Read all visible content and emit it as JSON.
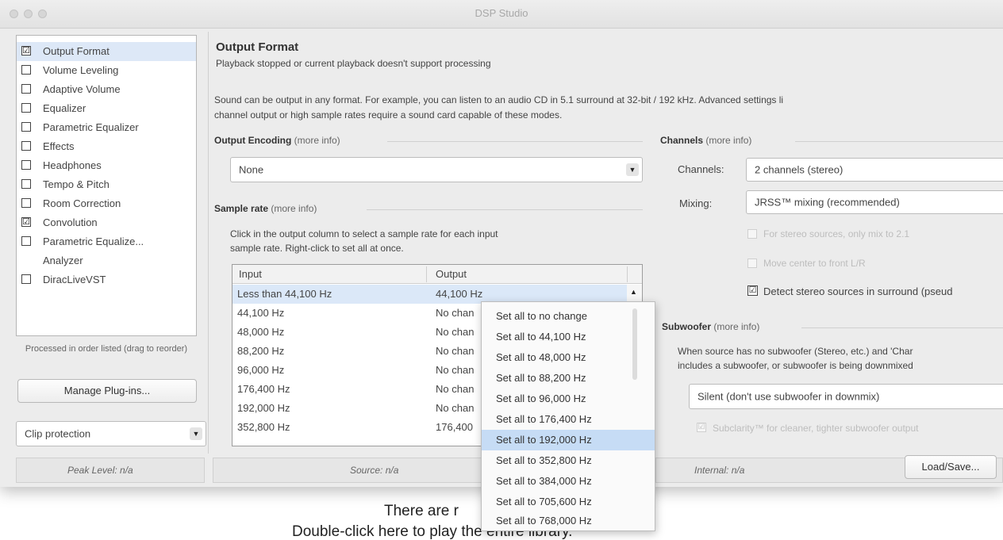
{
  "window": {
    "title": "DSP Studio"
  },
  "sidebar": {
    "items": [
      {
        "label": "Output Format",
        "checked": true,
        "selected": true
      },
      {
        "label": "Volume Leveling",
        "checked": false
      },
      {
        "label": "Adaptive Volume",
        "checked": false
      },
      {
        "label": "Equalizer",
        "checked": false
      },
      {
        "label": "Parametric Equalizer",
        "checked": false
      },
      {
        "label": "Effects",
        "checked": false
      },
      {
        "label": "Headphones",
        "checked": false
      },
      {
        "label": "Tempo & Pitch",
        "checked": false
      },
      {
        "label": "Room Correction",
        "checked": false
      },
      {
        "label": "Convolution",
        "checked": true
      },
      {
        "label": "Parametric Equalize...",
        "checked": false
      },
      {
        "label": "Analyzer",
        "checked": null
      },
      {
        "label": "DiracLiveVST",
        "checked": false
      }
    ],
    "order_note": "Processed in order listed (drag to reorder)",
    "manage_button": "Manage Plug-ins...",
    "clip_select": "Clip protection",
    "check_mark": "☑"
  },
  "main": {
    "title": "Output Format",
    "status_line": "Playback stopped or current playback doesn't support processing",
    "description_1": "Sound can be output in any format.  For example, you can listen to an audio CD in 5.1 surround at 32-bit / 192 kHz.  Advanced settings li",
    "description_2": "channel output or high sample rates require a sound card capable of these modes.",
    "encoding": {
      "label": "Output Encoding",
      "more": "(more info)",
      "value": "None"
    },
    "sample_rate": {
      "label": "Sample rate",
      "more": "(more info)",
      "hint_1": "Click in the output column to select a sample rate for each input",
      "hint_2": "sample rate.  Right-click to set all at once.",
      "columns": [
        "Input",
        "Output"
      ],
      "rows": [
        {
          "input": "Less than 44,100 Hz",
          "output": "44,100 Hz"
        },
        {
          "input": "44,100 Hz",
          "output": "No chan"
        },
        {
          "input": "48,000 Hz",
          "output": "No chan"
        },
        {
          "input": "88,200 Hz",
          "output": "No chan"
        },
        {
          "input": "96,000 Hz",
          "output": "No chan"
        },
        {
          "input": "176,400 Hz",
          "output": "No chan"
        },
        {
          "input": "192,000 Hz",
          "output": "No chan"
        },
        {
          "input": "352,800 Hz",
          "output": "176,400"
        }
      ]
    },
    "channels": {
      "label": "Channels",
      "more": "(more info)",
      "channels_label": "Channels:",
      "channels_value": "2 channels (stereo)",
      "mixing_label": "Mixing:",
      "mixing_value": "JRSS™ mixing (recommended)",
      "option_1": "For stereo sources, only mix to 2.1",
      "option_2": "Move center to front L/R",
      "option_3": "Detect stereo sources in surround (pseud"
    },
    "subwoofer": {
      "label": "Subwoofer",
      "more": "(more info)",
      "desc_1": "When source has no subwoofer (Stereo, etc.) and 'Char",
      "desc_2": "includes a subwoofer, or subwoofer is being downmixed",
      "select_value": "Silent (don't use subwoofer in downmix)",
      "subclarity": "Subclarity™ for cleaner, tighter subwoofer output"
    }
  },
  "context_menu": {
    "items": [
      "Set all to no change",
      "Set all to 44,100 Hz",
      "Set all to 48,000 Hz",
      "Set all to 88,200 Hz",
      "Set all to 96,000 Hz",
      "Set all to 176,400 Hz",
      "Set all to 192,000 Hz",
      "Set all to 352,800 Hz",
      "Set all to 384,000 Hz",
      "Set all to 705,600 Hz",
      "Set all to 768,000 Hz"
    ],
    "highlighted_index": 6
  },
  "status_bar": {
    "peak": "Peak Level: n/a",
    "source": "Source: n/a",
    "internal": "Internal: n/a",
    "load_save": "Load/Save..."
  },
  "background": {
    "line_1": "There are r",
    "line_2": "Double-click here to play the entire library."
  }
}
